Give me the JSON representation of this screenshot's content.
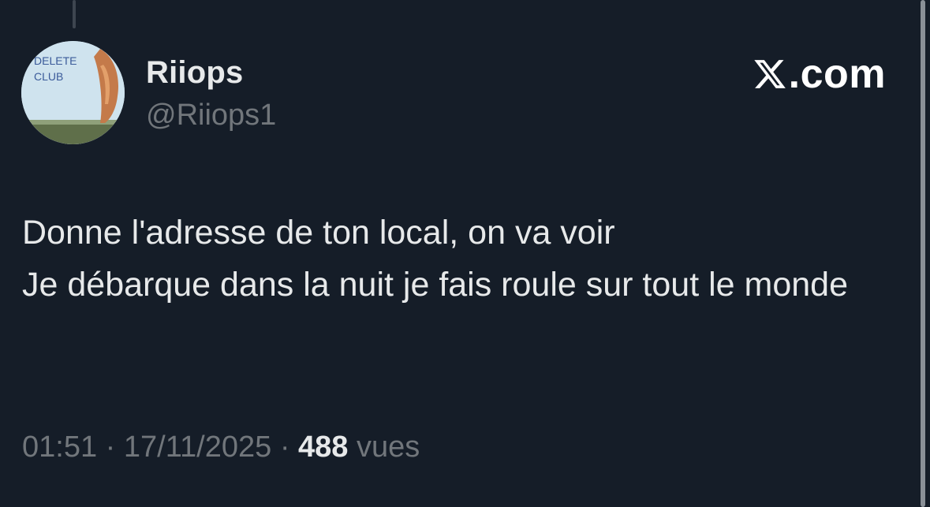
{
  "author": {
    "display_name": "Riiops",
    "handle": "@Riiops1",
    "avatar_text": "DELETE CLUB"
  },
  "brand": {
    "label": ".com",
    "icon": "x-logo-icon"
  },
  "tweet": {
    "text": "Donne l'adresse de ton local, on va voir\nJe débarque dans la nuit je fais roule sur tout le monde"
  },
  "meta": {
    "time": "01:51",
    "separator": "·",
    "date": "17/11/2025",
    "views_count": "488",
    "views_label": "vues"
  },
  "colors": {
    "background": "#151d28",
    "primary_text": "#e7e9ea",
    "secondary_text": "#71767b"
  }
}
